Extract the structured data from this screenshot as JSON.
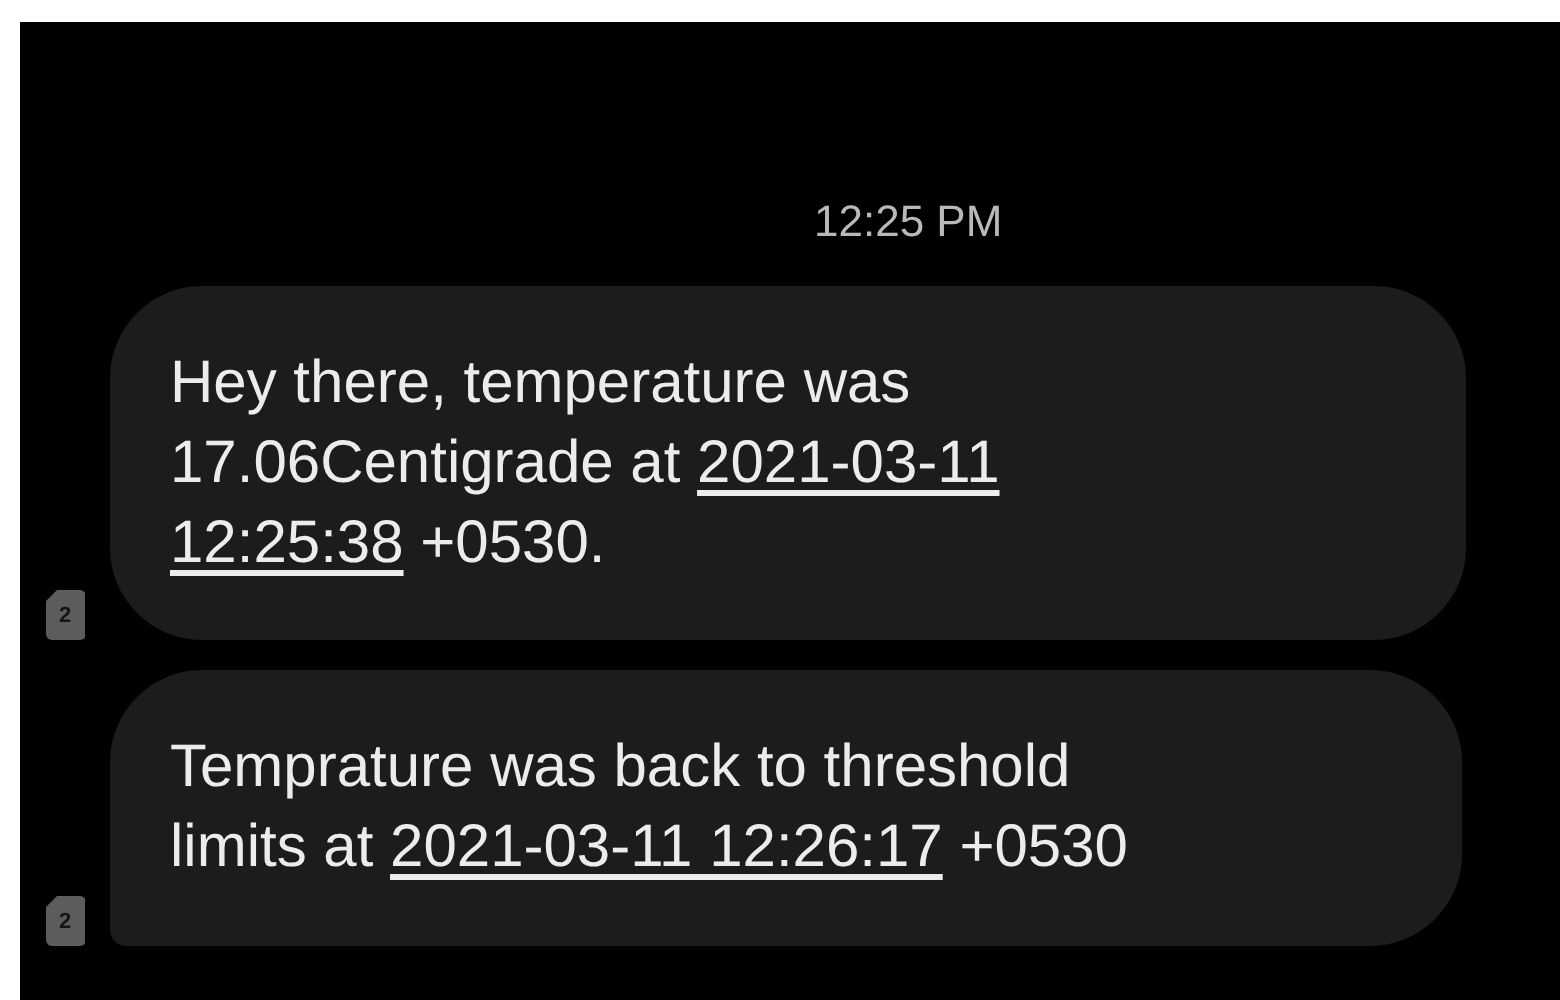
{
  "time": "12:25 PM",
  "messages": [
    {
      "sim": "2",
      "lines": [
        [
          {
            "kind": "text",
            "text": "Hey there, temperature was"
          }
        ],
        [
          {
            "kind": "text",
            "text": "17.06Centigrade at "
          },
          {
            "kind": "link",
            "text": "2021-03-11"
          }
        ],
        [
          {
            "kind": "link",
            "text": "12:25:38"
          },
          {
            "kind": "text",
            "text": " +0530."
          }
        ]
      ]
    },
    {
      "sim": "2",
      "lines": [
        [
          {
            "kind": "text",
            "text": "Temprature was back to threshold"
          }
        ],
        [
          {
            "kind": "text",
            "text": "limits at "
          },
          {
            "kind": "link",
            "text": "2021-03-11 12:26:17"
          },
          {
            "kind": "text",
            "text": " +0530"
          }
        ]
      ]
    }
  ]
}
